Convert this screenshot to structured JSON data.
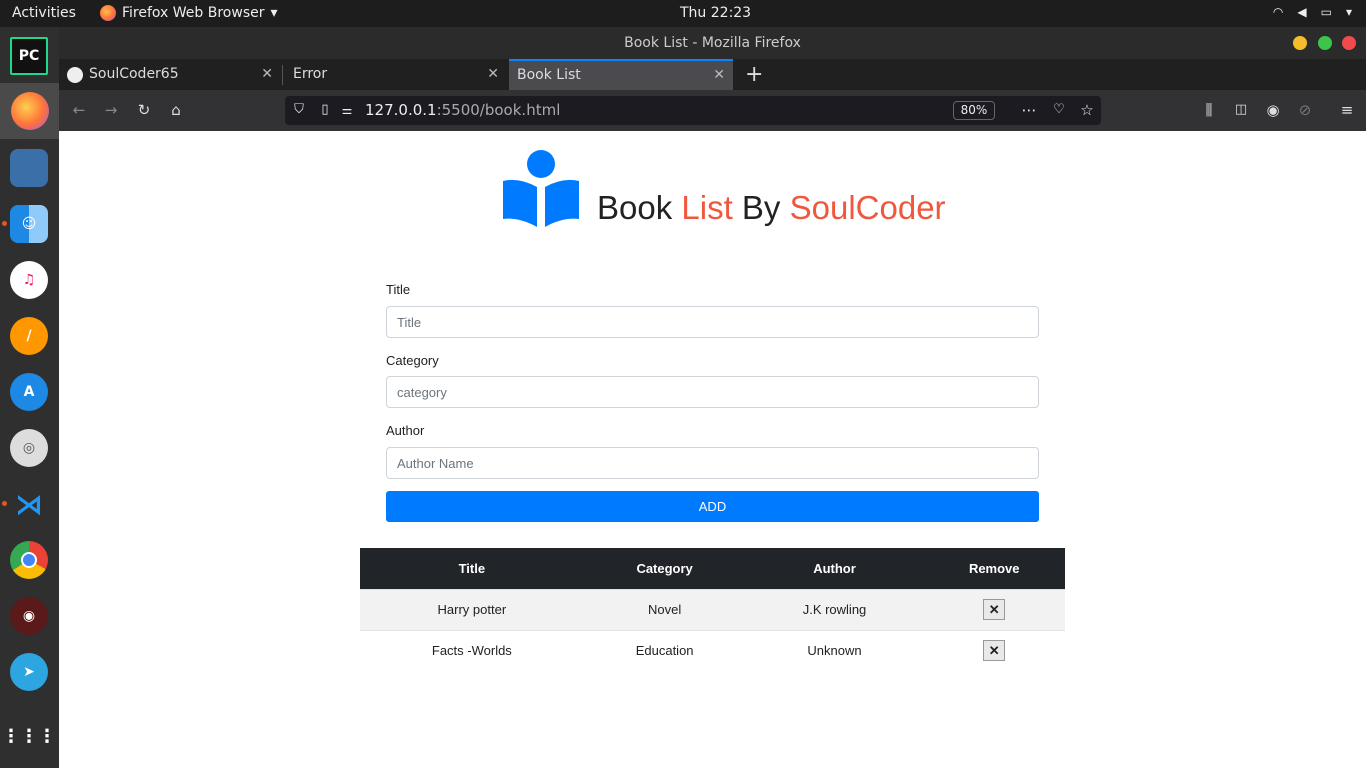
{
  "os": {
    "activities": "Activities",
    "app_menu": "Firefox Web Browser",
    "clock": "Thu 22:23"
  },
  "window": {
    "title": "Book List - Mozilla Firefox"
  },
  "tabs": [
    {
      "label": "SoulCoder65"
    },
    {
      "label": "Error"
    },
    {
      "label": "Book List"
    }
  ],
  "address": {
    "host": "127.0.0.1",
    "path": ":5500/book.html",
    "zoom": "80%"
  },
  "page": {
    "brand": {
      "w1": "Book",
      "w2": "List",
      "w3": "By",
      "w4": "SoulCoder",
      "accent": "#f0583e",
      "icon_color": "#007bff"
    },
    "form": {
      "title_label": "Title",
      "title_placeholder": "Title",
      "category_label": "Category",
      "category_placeholder": "category",
      "author_label": "Author",
      "author_placeholder": "Author Name",
      "add_label": "ADD"
    },
    "table": {
      "headers": [
        "Title",
        "Category",
        "Author",
        "Remove"
      ],
      "rows": [
        {
          "title": "Harry potter",
          "category": "Novel",
          "author": "J.K rowling",
          "remove": "✕"
        },
        {
          "title": "Facts -Worlds",
          "category": "Education",
          "author": "Unknown",
          "remove": "✕"
        }
      ]
    }
  }
}
